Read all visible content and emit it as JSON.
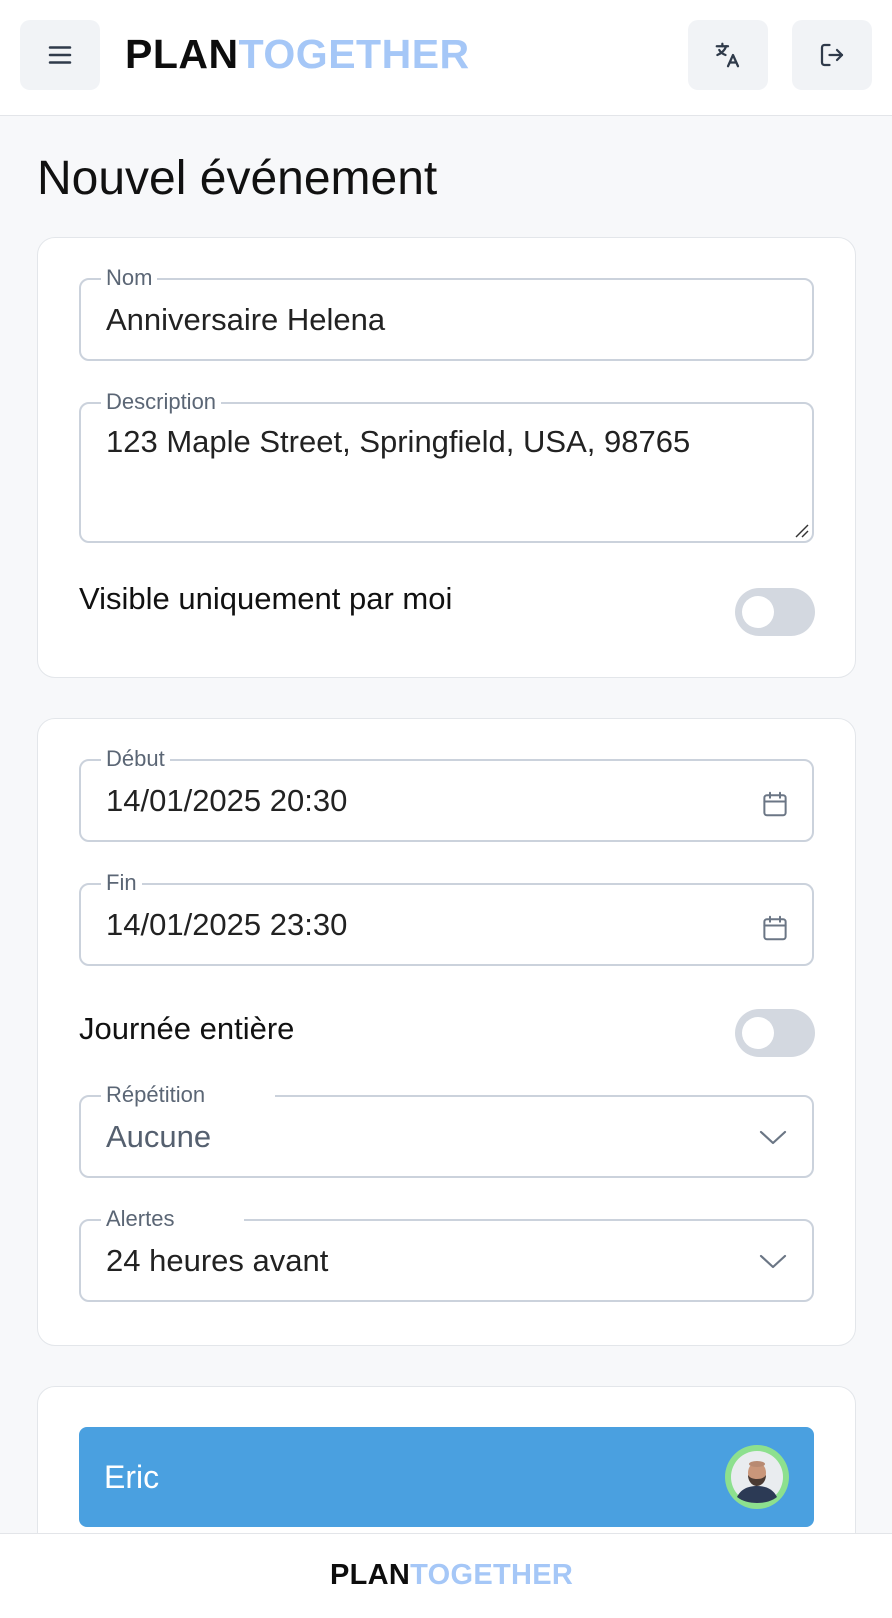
{
  "header": {
    "logo_part1": "PLAN",
    "logo_part2": "TOGETHER",
    "menu_icon": "hamburger-menu-icon",
    "language_icon": "translate-icon",
    "logout_icon": "logout-icon"
  },
  "page": {
    "title": "Nouvel événement"
  },
  "form": {
    "name": {
      "label": "Nom",
      "value": "Anniversaire Helena"
    },
    "description": {
      "label": "Description",
      "value": "123 Maple Street, Springfield, USA, 98765"
    },
    "private_toggle": {
      "label": "Visible uniquement par moi",
      "checked": false
    },
    "start": {
      "label": "Début",
      "value": "14/01/2025 20:30"
    },
    "end": {
      "label": "Fin",
      "value": "14/01/2025 23:30"
    },
    "all_day_toggle": {
      "label": "Journée entière",
      "checked": false
    },
    "repeat": {
      "label": "Répétition",
      "value": "Aucune"
    },
    "alerts": {
      "label": "Alertes",
      "value": "24 heures avant"
    }
  },
  "participants": [
    {
      "name": "Eric"
    }
  ],
  "footer": {
    "logo_part1": "PLAN",
    "logo_part2": "TOGETHER"
  },
  "colors": {
    "accent": "#4aa0e0",
    "logo_light": "#a5c7f7",
    "toggle_off": "#d3d8e0",
    "avatar_ring": "#8de08e"
  }
}
